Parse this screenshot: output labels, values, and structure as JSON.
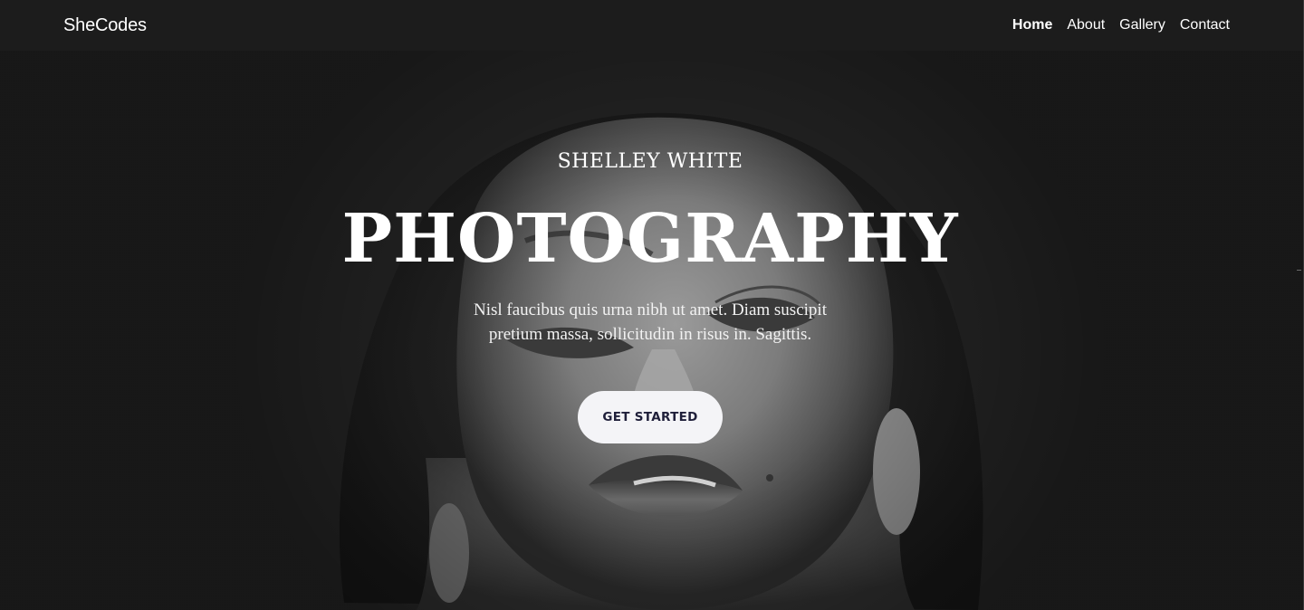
{
  "navbar": {
    "brand": "SheCodes",
    "links": [
      "Home",
      "About",
      "Gallery",
      "Contact"
    ],
    "active": "Home"
  },
  "hero": {
    "subtitle": "SHELLEY WHITE",
    "title": "PHOTOGRAPHY",
    "description": "Nisl faucibus quis urna nibh ut amet. Diam suscipit pretium massa, sollicitudin in risus in. Sagittis.",
    "cta_label": "GET STARTED",
    "photo_alt": "black-and-white portrait of a woman"
  },
  "colors": {
    "navbar_bg": "#1c1c1c",
    "hero_bg": "#222222",
    "cta_bg": "#f4f4f7",
    "cta_text": "#1f1f3a",
    "text": "#ffffff"
  }
}
